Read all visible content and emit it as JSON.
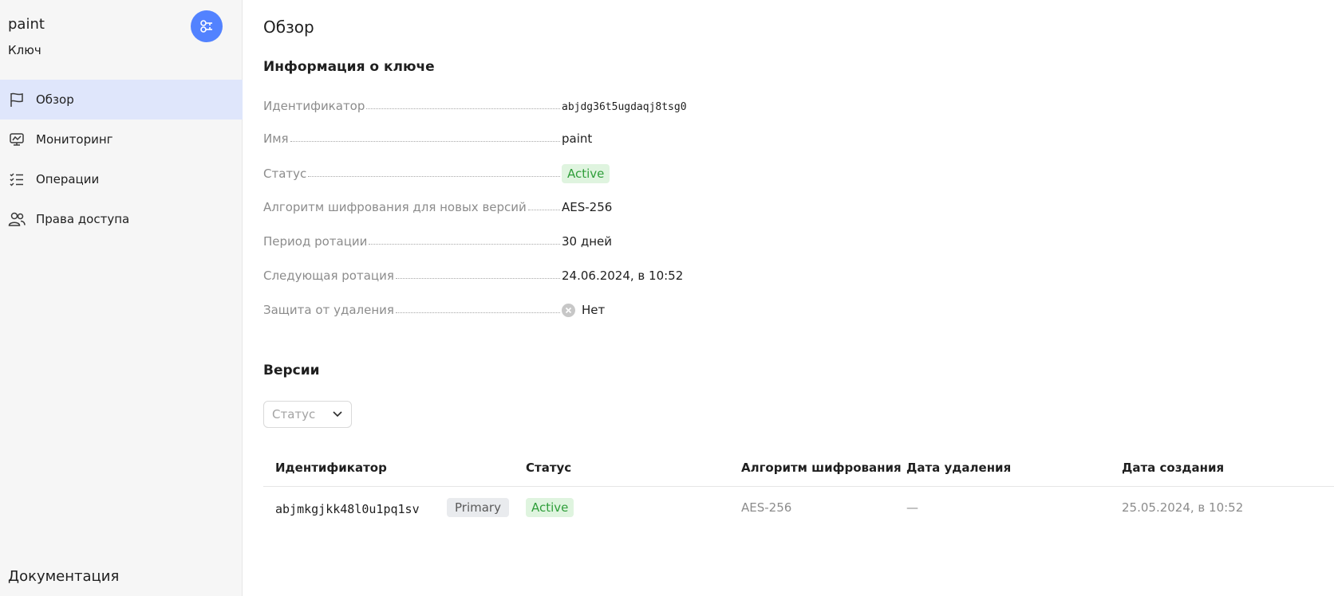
{
  "sidebar": {
    "title": "paint",
    "subtitle": "Ключ",
    "action_icon": "key-settings-icon",
    "items": [
      {
        "label": "Обзор",
        "icon": "flag-icon",
        "active": true
      },
      {
        "label": "Мониторинг",
        "icon": "monitor-chart-icon",
        "active": false
      },
      {
        "label": "Операции",
        "icon": "checklist-icon",
        "active": false
      },
      {
        "label": "Права доступа",
        "icon": "users-icon",
        "active": false
      }
    ],
    "docs_label": "Документация"
  },
  "main": {
    "page_title": "Обзор",
    "info_title": "Информация о ключе",
    "info": {
      "id_key": "Идентификатор",
      "id_val": "abjdg36t5ugdaqj8tsg0",
      "name_key": "Имя",
      "name_val": "paint",
      "status_key": "Статус",
      "status_val": "Active",
      "algo_key": "Алгоритм шифрования для новых версий",
      "algo_val": "AES-256",
      "period_key": "Период ротации",
      "period_val": "30 дней",
      "next_key": "Следующая ротация",
      "next_val": "24.06.2024, в 10:52",
      "protect_key": "Защита от удаления",
      "protect_val": "Нет"
    },
    "versions_title": "Версии",
    "filter_placeholder": "Статус",
    "table": {
      "headers": {
        "id": "Идентификатор",
        "status": "Статус",
        "algo": "Алгоритм шифрования",
        "deleted": "Дата удаления",
        "created": "Дата создания"
      },
      "rows": [
        {
          "id": "abjmkgjkk48l0u1pq1sv",
          "tag": "Primary",
          "status": "Active",
          "algo": "AES-256",
          "deleted": "—",
          "created": "25.05.2024, в 10:52"
        }
      ]
    }
  },
  "colors": {
    "accent": "#5282ff",
    "active_nav": "#dfe6fb",
    "status_active_bg": "#dff4df",
    "status_active_text": "#2f9e3a"
  }
}
